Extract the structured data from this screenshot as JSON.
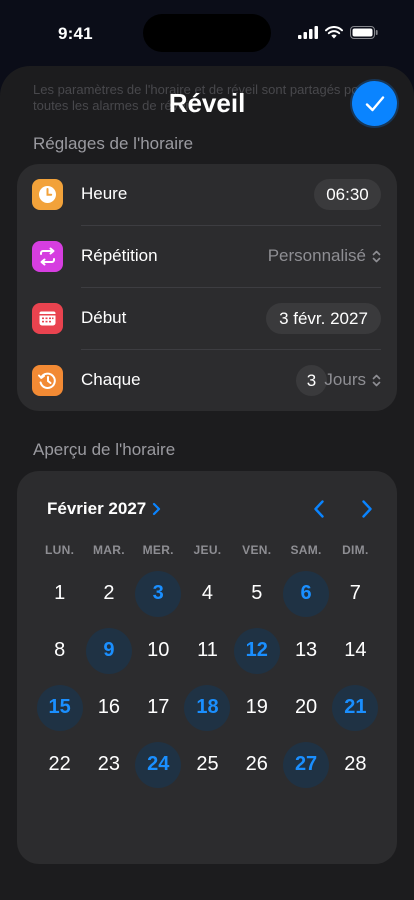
{
  "status_bar": {
    "time": "9:41"
  },
  "sheet": {
    "faded_text": "Les paramètres de l'horaire et de réveil sont partagés pour toutes les alarmes de réveil.",
    "title": "Réveil"
  },
  "schedule_settings": {
    "header": "Réglages de l'horaire",
    "rows": [
      {
        "label": "Heure",
        "value": "06:30",
        "icon": "clock-icon",
        "color": "#f2a23a"
      },
      {
        "label": "Répétition",
        "value": "Personnalisé",
        "icon": "repeat-icon",
        "color": "#d63ee0"
      },
      {
        "label": "Début",
        "value": "3 févr. 2027",
        "icon": "calendar-icon",
        "color": "#e9434f"
      },
      {
        "label": "Chaque",
        "value": "3",
        "unit": "Jours",
        "icon": "history-icon",
        "color": "#f28a34"
      }
    ]
  },
  "preview": {
    "header": "Aperçu de l'horaire",
    "month": "Février 2027",
    "weekdays": [
      "LUN.",
      "MAR.",
      "MER.",
      "JEU.",
      "VEN.",
      "SAM.",
      "DIM."
    ],
    "days": [
      {
        "n": "1",
        "sel": false
      },
      {
        "n": "2",
        "sel": false
      },
      {
        "n": "3",
        "sel": true
      },
      {
        "n": "4",
        "sel": false
      },
      {
        "n": "5",
        "sel": false
      },
      {
        "n": "6",
        "sel": true
      },
      {
        "n": "7",
        "sel": false
      },
      {
        "n": "8",
        "sel": false
      },
      {
        "n": "9",
        "sel": true
      },
      {
        "n": "10",
        "sel": false
      },
      {
        "n": "11",
        "sel": false
      },
      {
        "n": "12",
        "sel": true
      },
      {
        "n": "13",
        "sel": false
      },
      {
        "n": "14",
        "sel": false
      },
      {
        "n": "15",
        "sel": true
      },
      {
        "n": "16",
        "sel": false
      },
      {
        "n": "17",
        "sel": false
      },
      {
        "n": "18",
        "sel": true
      },
      {
        "n": "19",
        "sel": false
      },
      {
        "n": "20",
        "sel": false
      },
      {
        "n": "21",
        "sel": true
      },
      {
        "n": "22",
        "sel": false
      },
      {
        "n": "23",
        "sel": false
      },
      {
        "n": "24",
        "sel": true
      },
      {
        "n": "25",
        "sel": false
      },
      {
        "n": "26",
        "sel": false
      },
      {
        "n": "27",
        "sel": true
      },
      {
        "n": "28",
        "sel": false
      }
    ]
  },
  "colors": {
    "accent": "#0a84ff",
    "selected_day_bg": "#1f3244",
    "selected_day_text": "#1a8fff"
  }
}
